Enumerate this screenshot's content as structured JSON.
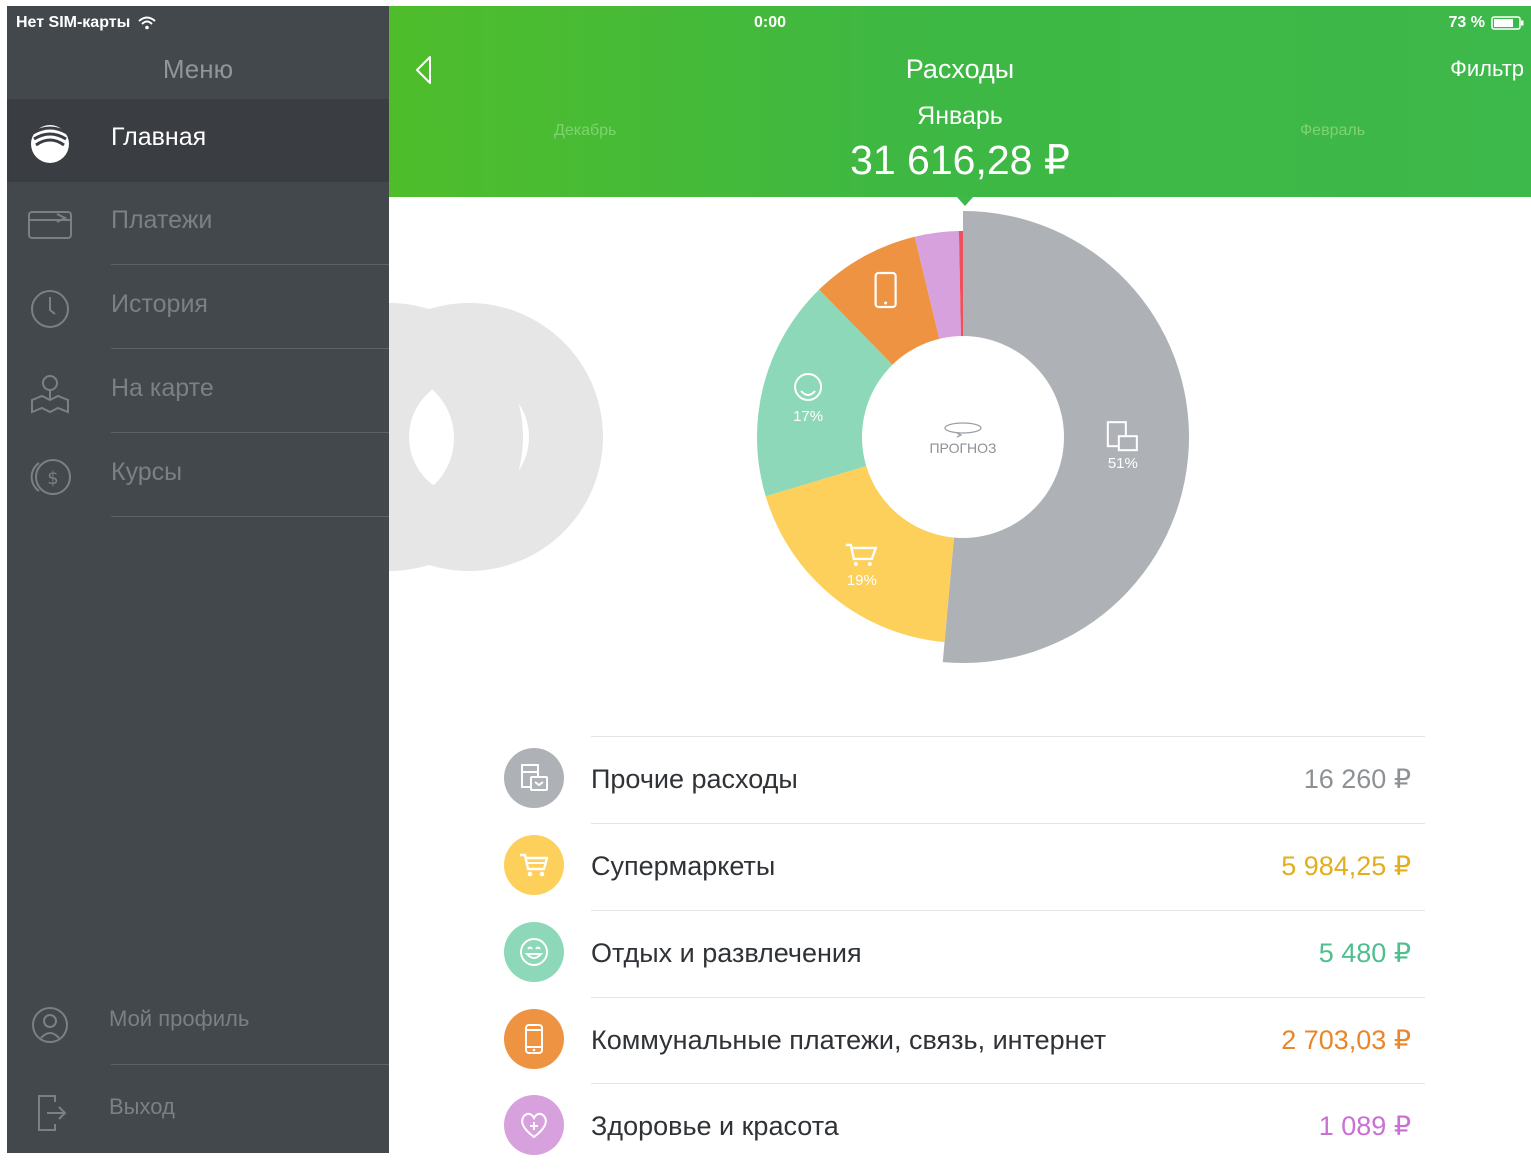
{
  "status_bar": {
    "carrier": "Нет SIM-карты",
    "time": "0:00",
    "battery": "73 %"
  },
  "sidebar": {
    "title": "Меню",
    "items": [
      {
        "label": "Главная",
        "icon": "sberbank-logo-icon",
        "active": true
      },
      {
        "label": "Платежи",
        "icon": "card-transfer-icon",
        "active": false
      },
      {
        "label": "История",
        "icon": "clock-icon",
        "active": false
      },
      {
        "label": "На карте",
        "icon": "map-pin-icon",
        "active": false
      },
      {
        "label": "Курсы",
        "icon": "currency-icon",
        "active": false
      }
    ],
    "footer": [
      {
        "label": "Мой профиль",
        "icon": "profile-icon"
      },
      {
        "label": "Выход",
        "icon": "logout-icon"
      }
    ]
  },
  "header": {
    "title": "Расходы",
    "filter_label": "Фильтр",
    "prev_month": "Декабрь",
    "current_month": "Январь",
    "next_month": "Февраль",
    "total": "31 616,28 ₽",
    "color": "#3db84a"
  },
  "chart_data": {
    "type": "pie",
    "center_label": "ПРОГНОЗ",
    "slices": [
      {
        "category": "Прочие расходы",
        "value": 16260,
        "percent_label": "51%",
        "color": "#aeb2b6",
        "icon": "receipt-icon"
      },
      {
        "category": "Супермаркеты",
        "value": 5984.25,
        "percent_label": "19%",
        "color": "#fdd05c",
        "icon": "cart-icon"
      },
      {
        "category": "Отдых и развлечения",
        "value": 5480,
        "percent_label": "17%",
        "color": "#8dd8b8",
        "icon": "smile-icon"
      },
      {
        "category": "Коммунальные платежи, связь, интернет",
        "value": 2703.03,
        "percent_label": "",
        "color": "#ee9342",
        "icon": "phone-icon"
      },
      {
        "category": "Здоровье и красота",
        "value": 1089,
        "percent_label": "",
        "color": "#d7a1dd",
        "icon": "heart-icon"
      },
      {
        "category": "",
        "value": 100,
        "percent_label": "",
        "color": "#ef4f5b",
        "icon": ""
      }
    ]
  },
  "categories": [
    {
      "name": "Прочие расходы",
      "amount": "16 260 ₽",
      "color": "#aeb2b6",
      "amount_color": "#8d9196",
      "icon": "receipt-icon"
    },
    {
      "name": "Супермаркеты",
      "amount": "5 984,25 ₽",
      "color": "#fdd05c",
      "amount_color": "#e3ae1c",
      "icon": "cart-icon"
    },
    {
      "name": "Отдых и развлечения",
      "amount": "5 480 ₽",
      "color": "#8dd8b8",
      "amount_color": "#4fbf8f",
      "icon": "smile-icon"
    },
    {
      "name": "Коммунальные платежи, связь, интернет",
      "amount": "2 703,03 ₽",
      "color": "#ee9342",
      "amount_color": "#e8862c",
      "icon": "phone-icon"
    },
    {
      "name": "Здоровье и красота",
      "amount": "1 089 ₽",
      "color": "#d7a1dd",
      "amount_color": "#c970d3",
      "icon": "heart-icon"
    }
  ]
}
